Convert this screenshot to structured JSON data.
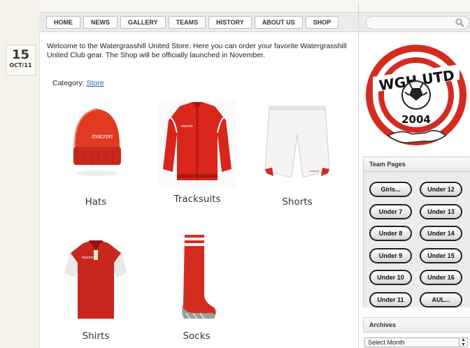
{
  "nav": {
    "items": [
      "HOME",
      "NEWS",
      "GALLERY",
      "TEAMS",
      "HISTORY",
      "ABOUT US",
      "SHOP"
    ]
  },
  "search": {
    "placeholder": "",
    "icon": "search-icon"
  },
  "post": {
    "date_day": "15",
    "date_month": "OCT/11",
    "intro": "Welcome to the Watergrasshill United Store. Here you can order your favorite Watergrasshill United Club gear. The Shop will be officially launched in November.",
    "category_label": "Category:",
    "category_link": "Store"
  },
  "products": [
    {
      "name": "Hats"
    },
    {
      "name": "Tracksuits"
    },
    {
      "name": "Shorts"
    },
    {
      "name": "Shirts"
    },
    {
      "name": "Socks"
    }
  ],
  "crest": {
    "top_text": "WGH UTD",
    "year": "2004"
  },
  "sidebar": {
    "team_pages_title": "Team Pages",
    "team_buttons": [
      "Girls...",
      "Under 12",
      "Under 7",
      "Under 13",
      "Under 8",
      "Under 14",
      "Under 9",
      "Under 15",
      "Under 10",
      "Under 16",
      "Under 11",
      "AUL..."
    ],
    "archives_title": "Archives",
    "archives_select": "Select Month"
  },
  "colors": {
    "brand_red": "#d42b20",
    "link": "#1a5fb4"
  }
}
